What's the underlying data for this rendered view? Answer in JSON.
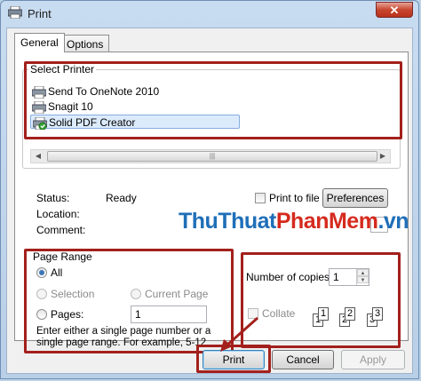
{
  "window": {
    "title": "Print",
    "close_symbol": "✕"
  },
  "tabs": [
    {
      "label": "General",
      "active": true
    },
    {
      "label": "Options",
      "active": false
    }
  ],
  "select_printer": {
    "label": "Select Printer",
    "printers": [
      {
        "name": "Send To OneNote 2010",
        "selected": false
      },
      {
        "name": "Snagit 10",
        "selected": false
      },
      {
        "name": "Solid PDF Creator",
        "selected": true
      }
    ],
    "status_label": "Status:",
    "status_value": "Ready",
    "location_label": "Location:",
    "location_value": "",
    "comment_label": "Comment:",
    "comment_value": "",
    "print_to_file_label": "Print to file",
    "print_to_file_checked": false,
    "preferences_label": "Preferences"
  },
  "page_range": {
    "label": "Page Range",
    "all_label": "All",
    "selection_label": "Selection",
    "current_page_label": "Current Page",
    "pages_label": "Pages:",
    "pages_value": "1",
    "hint": "Enter either a single page number or a single page range.  For example, 5-12",
    "selected_option": "All"
  },
  "copies": {
    "number_label": "Number of copies:",
    "number_value": "1",
    "collate_label": "Collate",
    "collate_checked": false
  },
  "buttons": {
    "print": "Print",
    "cancel": "Cancel",
    "apply": "Apply"
  },
  "watermark": {
    "part1": "ThuThuat",
    "part2": "PhanMem",
    "part3": ".vn"
  },
  "colors": {
    "highlight_box": "#a3201c",
    "selection_bg": "#dcebfc",
    "watermark_blue": "#1f6fb8",
    "watermark_red": "#d52b1e"
  }
}
